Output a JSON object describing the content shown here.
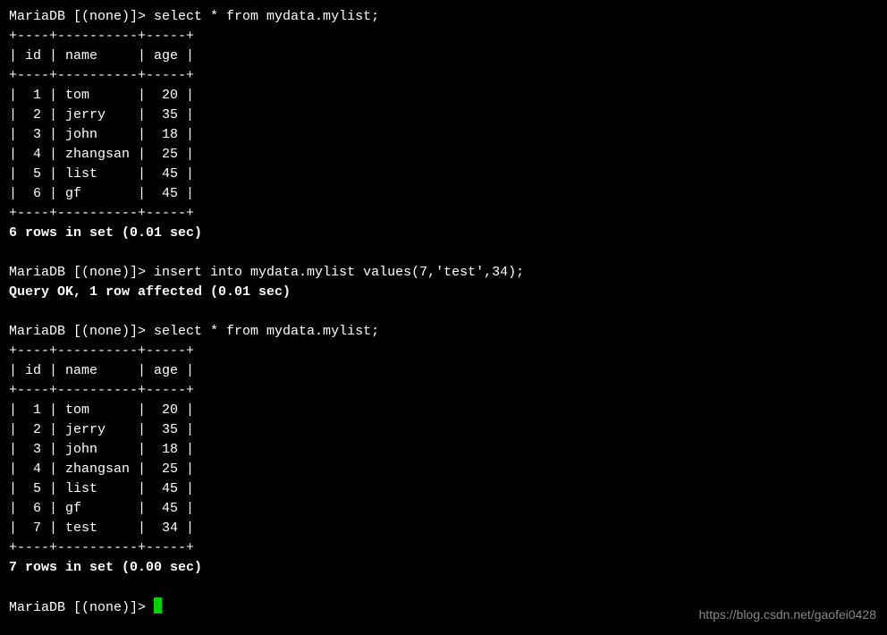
{
  "prompt": "MariaDB [(none)]> ",
  "block1": {
    "query": "select * from mydata.mylist;",
    "sep": "+----+----------+-----+",
    "header": "| id | name     | age |",
    "rows": [
      "|  1 | tom      |  20 |",
      "|  2 | jerry    |  35 |",
      "|  3 | john     |  18 |",
      "|  4 | zhangsan |  25 |",
      "|  5 | list     |  45 |",
      "|  6 | gf       |  45 |"
    ],
    "summary": "6 rows in set (0.01 sec)"
  },
  "block2": {
    "query": "insert into mydata.mylist values(7,'test',34);",
    "result": "Query OK, 1 row affected (0.01 sec)"
  },
  "block3": {
    "query": "select * from mydata.mylist;",
    "sep": "+----+----------+-----+",
    "header": "| id | name     | age |",
    "rows": [
      "|  1 | tom      |  20 |",
      "|  2 | jerry    |  35 |",
      "|  3 | john     |  18 |",
      "|  4 | zhangsan |  25 |",
      "|  5 | list     |  45 |",
      "|  6 | gf       |  45 |",
      "|  7 | test     |  34 |"
    ],
    "summary": "7 rows in set (0.00 sec)"
  },
  "watermark": "https://blog.csdn.net/gaofei0428",
  "chart_data": {
    "type": "table",
    "tables": [
      {
        "title": "mydata.mylist (before insert)",
        "columns": [
          "id",
          "name",
          "age"
        ],
        "rows": [
          [
            1,
            "tom",
            20
          ],
          [
            2,
            "jerry",
            35
          ],
          [
            3,
            "john",
            18
          ],
          [
            4,
            "zhangsan",
            25
          ],
          [
            5,
            "list",
            45
          ],
          [
            6,
            "gf",
            45
          ]
        ]
      },
      {
        "title": "mydata.mylist (after insert)",
        "columns": [
          "id",
          "name",
          "age"
        ],
        "rows": [
          [
            1,
            "tom",
            20
          ],
          [
            2,
            "jerry",
            35
          ],
          [
            3,
            "john",
            18
          ],
          [
            4,
            "zhangsan",
            25
          ],
          [
            5,
            "list",
            45
          ],
          [
            6,
            "gf",
            45
          ],
          [
            7,
            "test",
            34
          ]
        ]
      }
    ]
  }
}
